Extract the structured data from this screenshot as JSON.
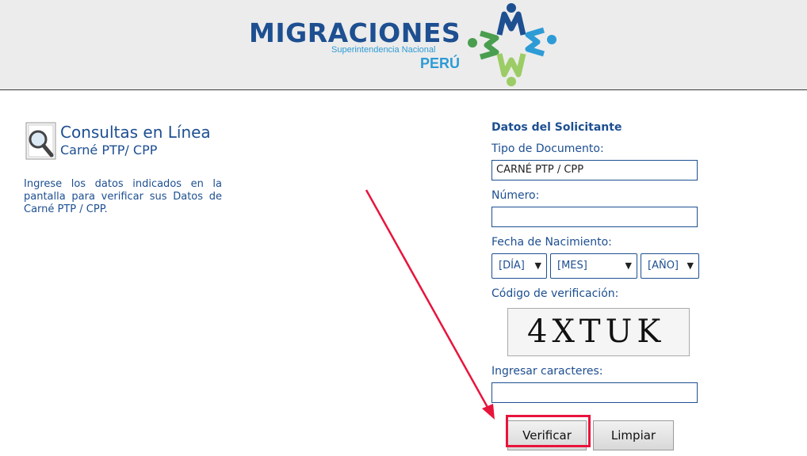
{
  "header": {
    "logo": {
      "name": "MIGRACIONES",
      "subtitle": "Superintendencia Nacional",
      "country": "PERÚ",
      "colors": {
        "navy": "#1d4f91",
        "cyan": "#2d9bd6",
        "green": "#4a9e4f",
        "lime": "#9ccc65"
      }
    }
  },
  "left": {
    "title": "Consultas en Línea",
    "subtitle": "Carné PTP/ CPP",
    "description": "Ingrese los datos indicados en la pantalla para verificar sus Datos de Carné PTP / CPP."
  },
  "form": {
    "section_title": "Datos del Solicitante",
    "tipo_label": "Tipo de Documento:",
    "tipo_value": "CARNÉ PTP / CPP",
    "numero_label": "Número:",
    "numero_value": "",
    "fecha_label": "Fecha de Nacimiento:",
    "dia": "[DÍA]",
    "mes": "[MES]",
    "anio": "[AÑO]",
    "codigo_label": "Código de verificación:",
    "captcha_text": "4XTUK",
    "ingresar_label": "Ingresar caracteres:",
    "ingresar_value": "",
    "verificar": "Verificar",
    "limpiar": "Limpiar"
  },
  "annotation": {
    "color": "#e8143c"
  }
}
